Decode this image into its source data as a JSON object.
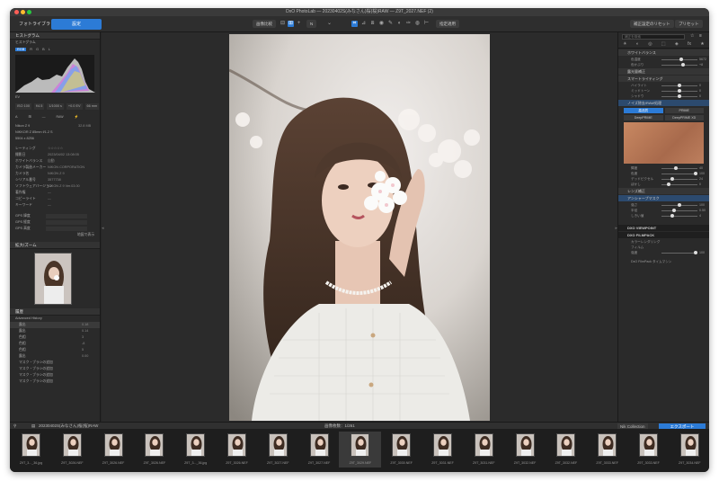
{
  "window": {
    "title": "DxO PhotoLab — 20230402S(みなさん)桜(桜)RAW — Z9T_2027.NEF (2)"
  },
  "tabs": {
    "library": "フォトライブラリ",
    "customize": "設定"
  },
  "toolbar": {
    "compare": "画像比較",
    "zoom": "N",
    "apply": "指定適用",
    "reset": "補正設定のリセット",
    "preset": "プリセット"
  },
  "left": {
    "histogram": "ヒストグラム",
    "histogram_label": "ヒストグラム",
    "rgb": "RGB",
    "r": "R",
    "g": "G",
    "b": "B",
    "l": "L",
    "ev_label": "EV",
    "exif": [
      "ISO 100",
      "f/4.5",
      "1/1000 s",
      "+0.0 EV",
      "66 mm"
    ],
    "camera": "Nikon Z 9",
    "filesize": "32.8 MB",
    "lens": "NIKKOR Z 85mm f/1.2 S",
    "dims": "5504 x 8256",
    "meta": [
      {
        "k": "レーティング",
        "v": "☆☆☆☆☆"
      },
      {
        "k": "撮影日",
        "v": "2023/04/02 13:08:05"
      },
      {
        "k": "ホワイトバランス",
        "v": "自動"
      },
      {
        "k": "カメラ製造メーカー",
        "v": "NIKON CORPORATION"
      },
      {
        "k": "カメラ名",
        "v": "NIKON Z 9"
      },
      {
        "k": "シリアル番号",
        "v": "3577738"
      },
      {
        "k": "ソフトウェアバージョン",
        "v": "NIKON Z 9 Ver.03.00"
      },
      {
        "k": "著作権",
        "v": "—"
      },
      {
        "k": "コピーライト",
        "v": "—"
      },
      {
        "k": "キーワード",
        "v": "—"
      }
    ],
    "gps": [
      "GPS 緯度",
      "GPS 経度",
      "GPS 高度"
    ],
    "gps_btn": "地図で表示",
    "loupe_title": "拡大/ズーム",
    "history_title": "履歴",
    "history_root": "Advanced History",
    "history": [
      {
        "k": "露出",
        "v": "0.18"
      },
      {
        "k": "露出",
        "v": "0.14"
      },
      {
        "k": "色相",
        "v": "3"
      },
      {
        "k": "色相",
        "v": "-8"
      },
      {
        "k": "色相",
        "v": "5"
      },
      {
        "k": "露出",
        "v": "0.00"
      },
      {
        "k": "マスク・ブラシの追加",
        "v": ""
      },
      {
        "k": "マスク・ブラシの追加",
        "v": ""
      },
      {
        "k": "マスク・ブラシの追加",
        "v": ""
      },
      {
        "k": "マスク・ブラシの追加",
        "v": ""
      }
    ]
  },
  "right": {
    "search_placeholder": "補正を検索",
    "sections": [
      {
        "title": "ホワイトバランス",
        "rows": [
          {
            "k": "色温度",
            "v": "5672",
            "p": 0.55
          },
          {
            "k": "色かぶり",
            "v": "+8",
            "p": 0.6
          }
        ]
      },
      {
        "title": "露光量補正",
        "rows": []
      },
      {
        "title": "スマートライティング",
        "rows": [
          {
            "k": "ハイライト",
            "v": "0",
            "p": 0.5
          },
          {
            "k": "ミッドトーン",
            "v": "0",
            "p": 0.5
          },
          {
            "k": "シャドウ",
            "v": "0",
            "p": 0.5
          }
        ]
      },
      {
        "title": "ノイズ除去/RAW処理",
        "rows": []
      }
    ],
    "denoise": {
      "hq": "高品質",
      "prime": "PRIME",
      "deep": "DeepPRIME",
      "deepxd": "DeepPRIME XD"
    },
    "denoise_rows": [
      {
        "k": "輝度",
        "v": "40",
        "p": 0.4
      },
      {
        "k": "色度",
        "v": "100",
        "p": 0.95
      },
      {
        "k": "デッドピクセル",
        "v": "24",
        "p": 0.3
      },
      {
        "k": "ぼかし",
        "v": "0",
        "p": 0.2
      }
    ],
    "lens_title": "レンズ補正",
    "lens_rows": [
      {
        "k": "レンズ",
        "v": ""
      },
      {
        "k": "シャープネス",
        "v": ""
      }
    ],
    "sharp_title": "アンシャープマスク",
    "sharp_rows": [
      {
        "k": "強さ",
        "v": "100",
        "p": 0.5
      },
      {
        "k": "半径",
        "v": "0.50",
        "p": 0.35
      },
      {
        "k": "しきい値",
        "v": "4",
        "p": 0.3
      }
    ],
    "view_title": "DXO VIEWPOINT",
    "film_title": "DXO FILMPACK",
    "film_rows": [
      {
        "k": "カラーレンダリング",
        "v": ""
      },
      {
        "k": "フィルム",
        "v": ""
      },
      {
        "k": "強度",
        "v": "100",
        "p": 0.95
      }
    ],
    "timeline": "DxO FilmPack タイムマシン",
    "nik": "Nik Collection",
    "export": "エクスポート"
  },
  "filmbar": {
    "path": "20230402S(みなさん)桜(桜)RAW",
    "count_label": "画像枚数：",
    "count": "1/261"
  },
  "thumbs": [
    "Z9T_3..._36.jpg",
    "Z9T_3026.NEF",
    "Z9T_3026.NEF",
    "Z9T_3026.NEF",
    "Z9T_3..._36.jpg",
    "Z9T_3026.NEF",
    "Z9T_3027.NEF",
    "Z9T_3027.NEF",
    "Z9T_3029.NEF",
    "Z9T_3030.NEF",
    "Z9T_3031.NEF",
    "Z9T_3031.NEF",
    "Z9T_3032.NEF",
    "Z9T_3032.NEF",
    "Z9T_3033.NEF",
    "Z9T_3033.NEF",
    "Z9T_3034.NEF"
  ],
  "colors": {
    "accent": "#2c7bd6",
    "bg": "#262626"
  }
}
